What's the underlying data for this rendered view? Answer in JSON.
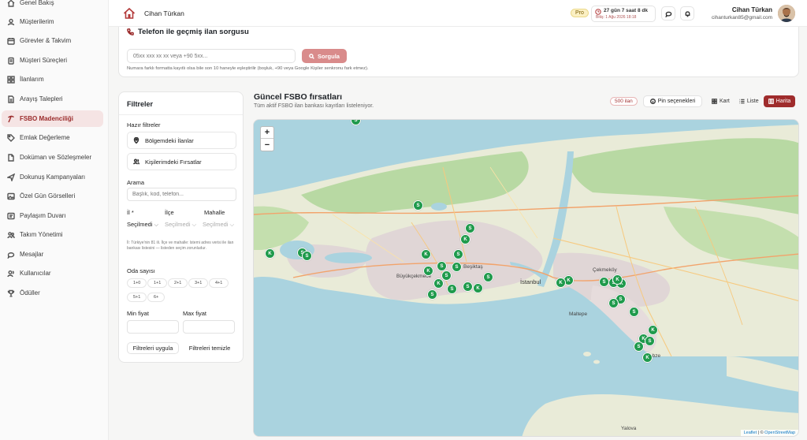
{
  "sidebar": {
    "items": [
      {
        "label": "Genel Bakış",
        "icon": "home-icon"
      },
      {
        "label": "Müşterilerim",
        "icon": "users-icon"
      },
      {
        "label": "Görevler & Takvim",
        "icon": "calendar-icon"
      },
      {
        "label": "Müşteri Süreçleri",
        "icon": "clipboard-icon"
      },
      {
        "label": "İlanlarım",
        "icon": "grid-icon"
      },
      {
        "label": "Arayış Talepleri",
        "icon": "document-icon"
      },
      {
        "label": "FSBO Madenciliği",
        "icon": "pickaxe-icon",
        "active": true
      },
      {
        "label": "Emlak Değerleme",
        "icon": "tag-icon"
      },
      {
        "label": "Doküman ve Sözleşmeler",
        "icon": "file-icon"
      },
      {
        "label": "Dokunuş Kampanyaları",
        "icon": "send-icon"
      },
      {
        "label": "Özel Gün Görselleri",
        "icon": "image-icon"
      },
      {
        "label": "Paylaşım Duvarı",
        "icon": "share-icon"
      },
      {
        "label": "Takım Yönetimi",
        "icon": "team-icon"
      },
      {
        "label": "Mesajlar",
        "icon": "chat-icon"
      },
      {
        "label": "Kullanıcılar",
        "icon": "user-group-icon"
      },
      {
        "label": "Ödüller",
        "icon": "trophy-icon"
      }
    ]
  },
  "header": {
    "brand": "Cihan Türkan",
    "plan_badge": "Pro",
    "trial_main": "27 gün 7 saat 8 dk",
    "trial_sub": "Bitiş: 1 Ağu 2026 18:18",
    "user_name": "Cihan Türkan",
    "user_email": "cihanturkan85@gmail.com"
  },
  "phone_query": {
    "title": "Telefon ile geçmiş ilan sorgusu",
    "input_placeholder": "05xx xxx xx xx veya +90 5xx...",
    "button_label": "Sorgula",
    "note": "Numara farklı formatta kayıtlı olsa bile son 10 haneyle eşleştirilir (boşluk, +90 veya Google Kişiler senkronu fark etmez)."
  },
  "filters": {
    "title": "Filtreler",
    "quick_label": "Hazır filtreler",
    "quick": [
      "Bölgemdeki İlanlar",
      "Kişilerimdeki Fırsatlar"
    ],
    "search_label": "Arama",
    "search_placeholder": "Başlık, kod, telefon...",
    "il_label": "İl *",
    "ilce_label": "İlçe",
    "mahalle_label": "Mahalle",
    "il_value": "Seçilmedi",
    "ilce_value": "Seçilmedi",
    "mahalle_value": "Seçilmedi",
    "location_note": "İl: Türkiye'nin 81 ili. İlçe ve mahalle: lstemi adres verisi ile ilan bankası listesini — listeden seçim zorunludur.",
    "rooms_label": "Oda sayısı",
    "rooms": [
      "1+0",
      "1+1",
      "2+1",
      "3+1",
      "4+1",
      "5+1",
      "6+"
    ],
    "min_price_label": "Min fiyat",
    "max_price_label": "Max fiyat",
    "apply_label": "Filtreleri uygula",
    "clear_label": "Filtreleri temizle"
  },
  "results": {
    "title": "Güncel FSBO fırsatları",
    "subtitle": "Tüm aktif FSBO ilan bankası kayıtları listeleniyor.",
    "count_badge": "500 ilan",
    "pin_options_label": "Pin seçenekleri",
    "views": [
      {
        "label": "Kart",
        "icon": "grid-icon"
      },
      {
        "label": "Liste",
        "icon": "list-icon"
      },
      {
        "label": "Harita",
        "icon": "map-icon",
        "active": true
      }
    ]
  },
  "map": {
    "zoom_in": "+",
    "zoom_out": "−",
    "attribution_leaflet": "Leaflet",
    "attribution_sep": " | © ",
    "attribution_osm": "OpenStreetMap",
    "city_label": "İstanbul",
    "label_yalova": "Yalova",
    "label_buyukcekmece": "Büyükçekmece",
    "label_besiktas": "Beşiktaş",
    "label_maltepe": "Maltepe",
    "label_cekmekoy": "Çekmeköy",
    "label_gebze": "Gebze",
    "pin_colors": {
      "pin": "#1f9a4c"
    },
    "pins": [
      "S",
      "S",
      "S",
      "K",
      "K",
      "S",
      "S",
      "S",
      "K",
      "S",
      "S",
      "K",
      "K",
      "S",
      "S",
      "S",
      "S",
      "S",
      "K",
      "K",
      "K",
      "S",
      "S",
      "K",
      "K",
      "S",
      "S",
      "S",
      "K",
      "K",
      "S",
      "S",
      "K"
    ]
  },
  "colors": {
    "accent": "#9f2c2c",
    "active_bg": "#f5e4e4",
    "pin": "#1f9a4c",
    "sea": "#aad3df"
  }
}
